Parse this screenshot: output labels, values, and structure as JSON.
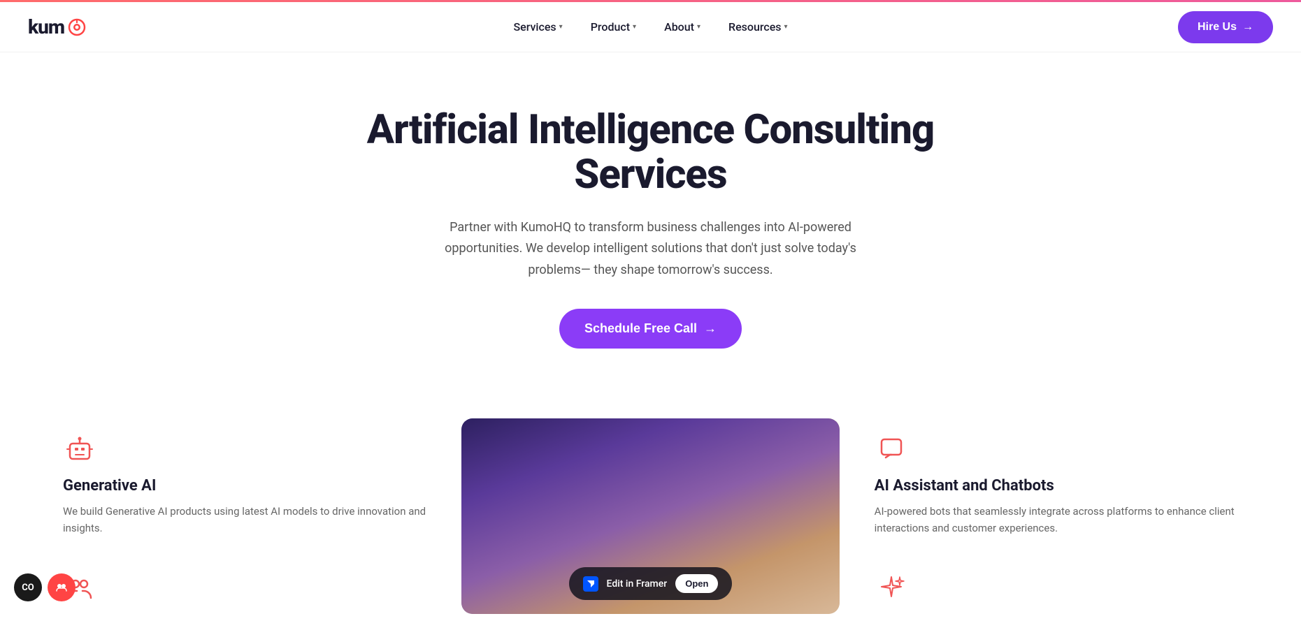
{
  "topBorder": {},
  "navbar": {
    "logo": {
      "text_part1": "kum",
      "text_part2": "o"
    },
    "navItems": [
      {
        "label": "Services",
        "hasDropdown": true
      },
      {
        "label": "Product",
        "hasDropdown": true
      },
      {
        "label": "About",
        "hasDropdown": true
      },
      {
        "label": "Resources",
        "hasDropdown": true
      }
    ],
    "hireButton": {
      "label": "Hire Us",
      "arrow": "→"
    }
  },
  "hero": {
    "title": "Artificial Intelligence Consulting Services",
    "subtitle": "Partner with KumoHQ to transform business challenges into AI-powered opportunities. We develop intelligent solutions that don't just solve today's problems— they shape tomorrow's success.",
    "ctaButton": {
      "label": "Schedule Free Call",
      "arrow": "→"
    }
  },
  "features": {
    "left": [
      {
        "icon": "robot-icon",
        "title": "Generative AI",
        "description": "We build Generative AI products using latest AI models to drive innovation and insights."
      },
      {
        "icon": "people-icon",
        "title": "",
        "description": ""
      }
    ],
    "right": [
      {
        "icon": "chat-icon",
        "title": "AI Assistant and Chatbots",
        "description": "AI-powered bots that seamlessly integrate across platforms to enhance client interactions and customer experiences."
      },
      {
        "icon": "sparkle-icon",
        "title": "",
        "description": ""
      }
    ]
  },
  "framerBar": {
    "logoText": "F",
    "editLabel": "Edit in Framer",
    "openLabel": "Open"
  },
  "cookieBar": {
    "cookieLabel": "CO",
    "chatLabel": "👥"
  }
}
